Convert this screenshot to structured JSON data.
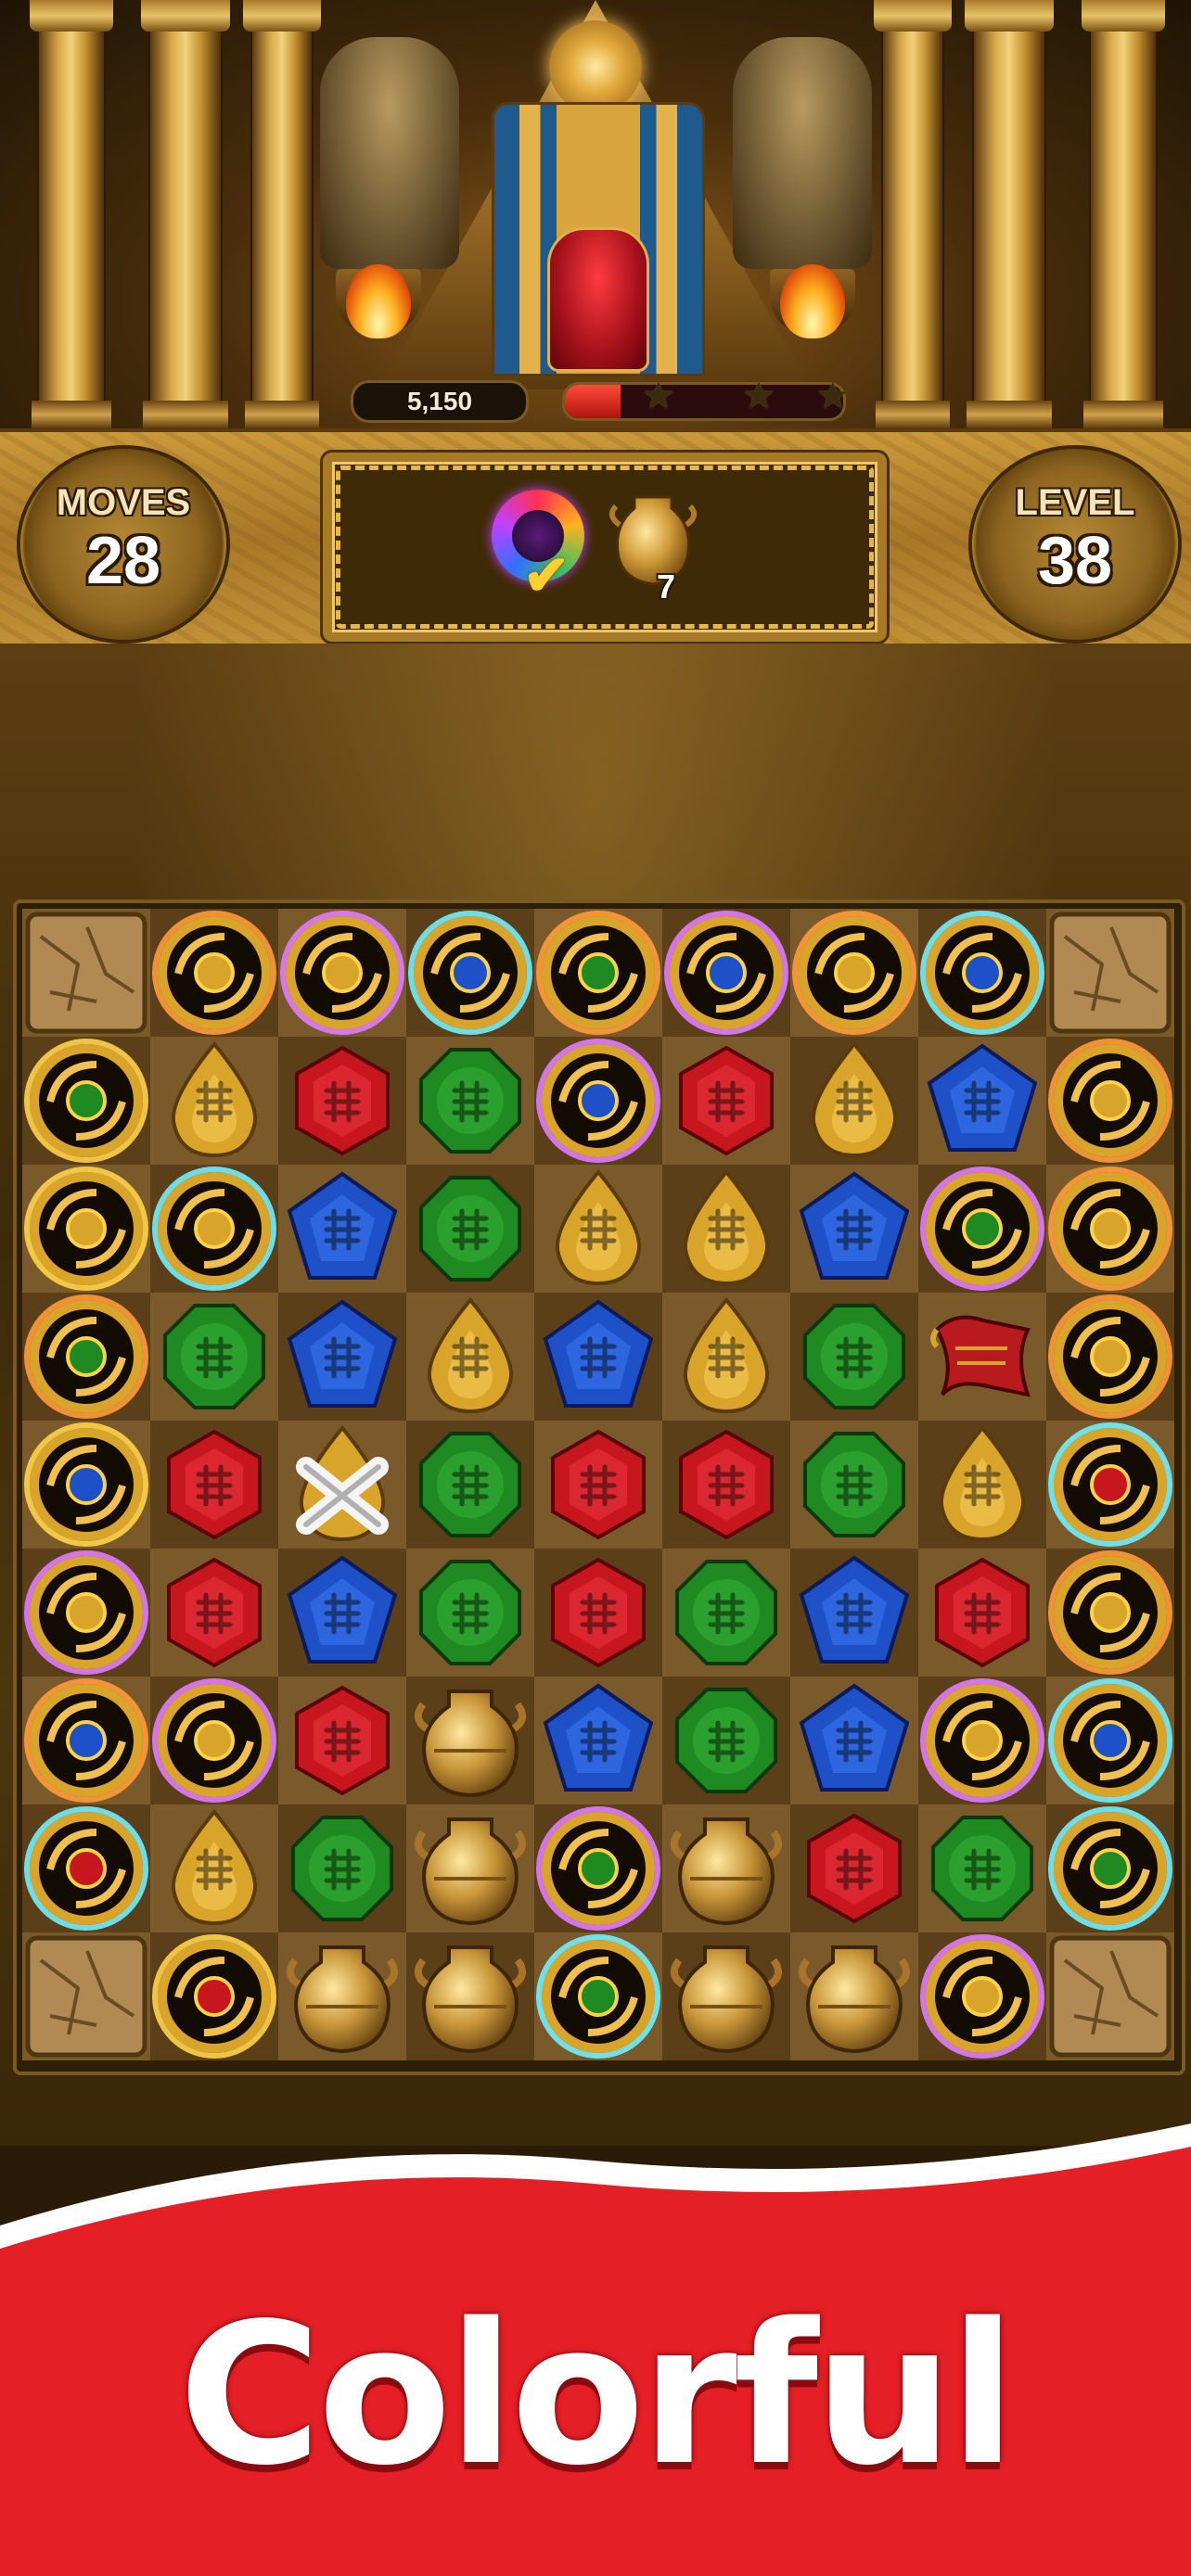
{
  "hud": {
    "score": "5,150",
    "score_progress": 0.2,
    "stars_earned": 0,
    "stars_total": 3,
    "moves_label": "MOVES",
    "moves_value": "28",
    "level_label": "LEVEL",
    "level_value": "38"
  },
  "goals": [
    {
      "icon": "rainbow-orb-icon",
      "status": "complete"
    },
    {
      "icon": "golden-vase-icon",
      "remaining": "7"
    }
  ],
  "board": {
    "columns": 9,
    "rows": 9,
    "grid": [
      [
        "stone",
        "orb",
        "orb",
        "orb",
        "orb",
        "orb",
        "orb",
        "orb",
        "stone"
      ],
      [
        "orb",
        "yellow-drop",
        "red-hex",
        "green-oct",
        "orb",
        "red-hex",
        "yellow-drop",
        "blue-pent",
        "orb"
      ],
      [
        "orb",
        "orb",
        "blue-pent",
        "green-oct",
        "yellow-drop",
        "yellow-drop",
        "blue-pent",
        "orb",
        "orb"
      ],
      [
        "orb",
        "green-oct",
        "blue-pent",
        "yellow-drop",
        "blue-pent",
        "yellow-drop",
        "green-oct",
        "scroll",
        "orb"
      ],
      [
        "orb",
        "red-hex",
        "white-drop",
        "green-oct",
        "red-hex",
        "red-hex",
        "green-oct",
        "yellow-drop",
        "orb"
      ],
      [
        "orb",
        "red-hex",
        "blue-pent",
        "green-oct",
        "red-hex",
        "green-oct",
        "blue-pent",
        "red-hex",
        "orb"
      ],
      [
        "orb",
        "orb",
        "red-hex",
        "vase",
        "blue-pent",
        "green-oct",
        "blue-pent",
        "orb",
        "orb"
      ],
      [
        "orb",
        "yellow-drop",
        "green-oct",
        "vase",
        "orb",
        "vase",
        "red-hex",
        "green-oct",
        "orb"
      ],
      [
        "stone",
        "orb",
        "vase",
        "vase",
        "orb",
        "vase",
        "vase",
        "orb",
        "stone"
      ]
    ]
  },
  "colors": {
    "red": "#c8161e",
    "green": "#1f8a22",
    "blue": "#1e50c8",
    "yellow": "#d9a42a",
    "gold": "#c9973a",
    "banner_red": "#e41f26"
  },
  "banner": {
    "text": "Colorful"
  }
}
